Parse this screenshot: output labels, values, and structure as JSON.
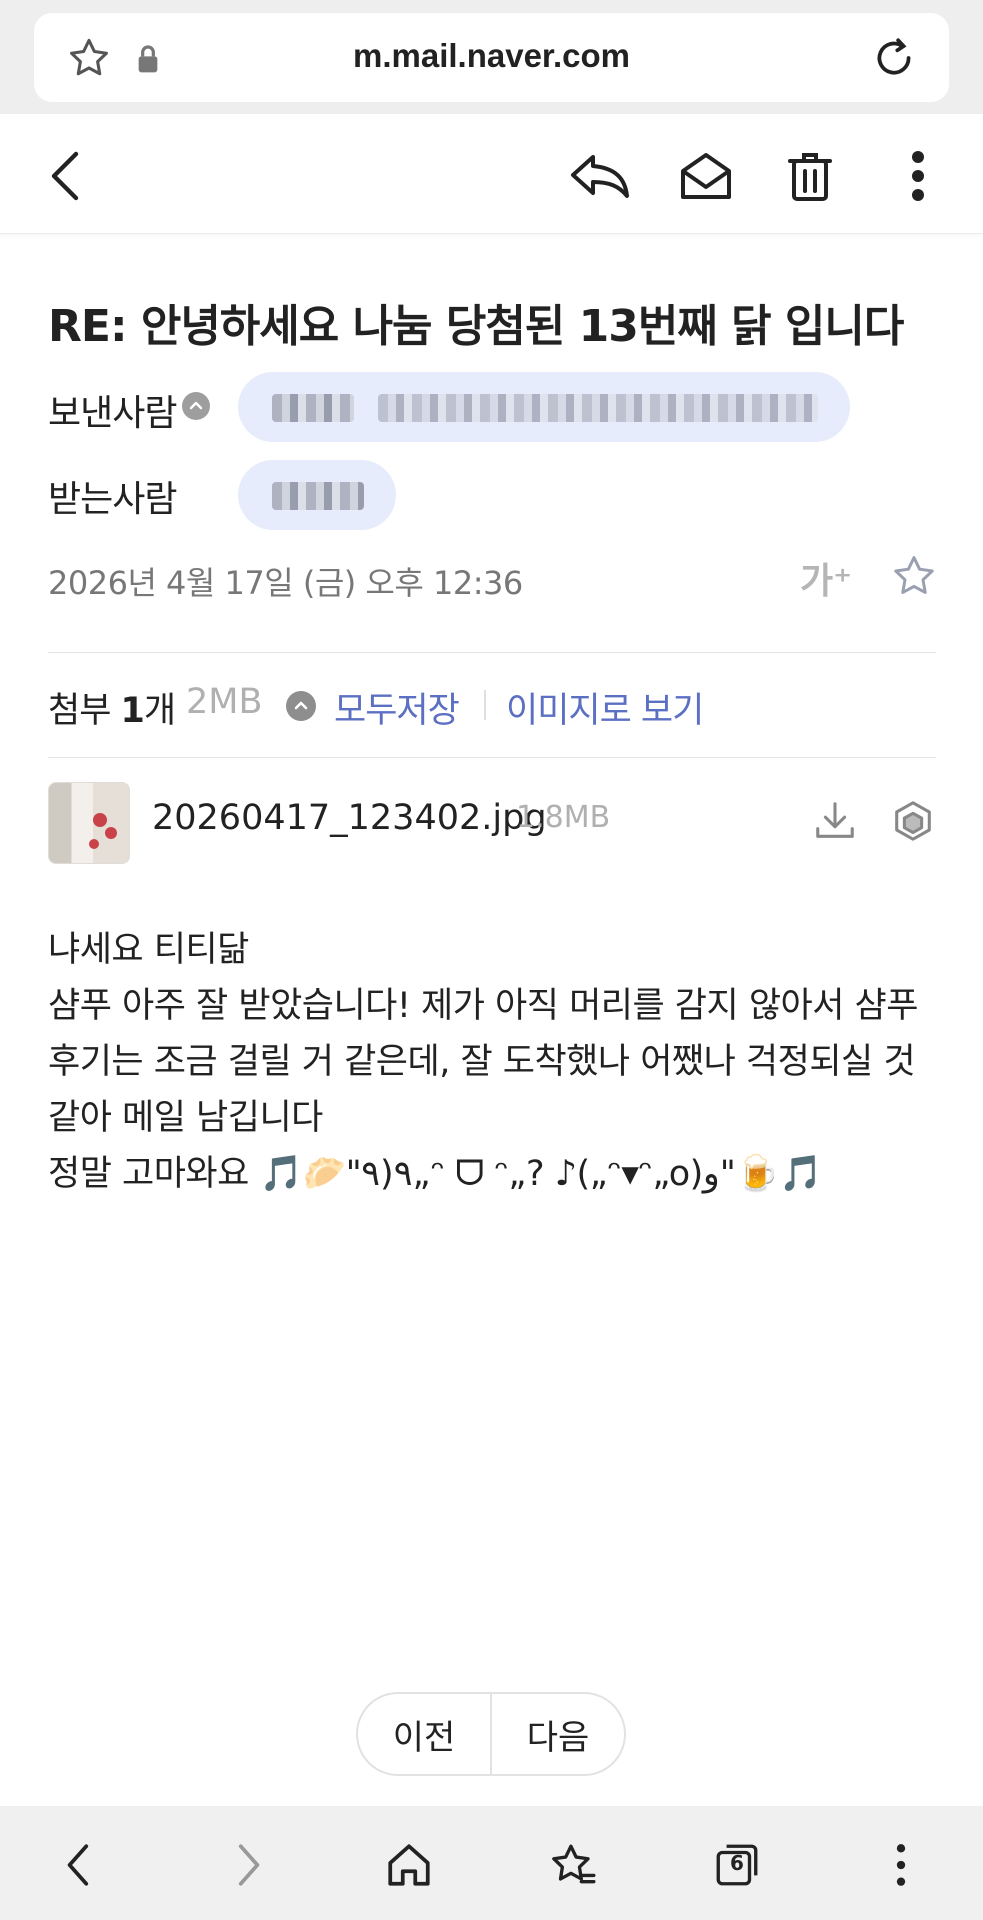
{
  "browser": {
    "url": "m.mail.naver.com"
  },
  "mail": {
    "subject": "RE: 안녕하세요 나눔 당첨된 13번째 닭 입니다",
    "sender_label": "보낸사람",
    "recipient_label": "받는사람",
    "date": "2026년 4월 17일 (금) 오후 12:36",
    "font_size_label": "가⁺",
    "attachments": {
      "label_prefix": "첨부 ",
      "count": "1",
      "label_suffix": "개",
      "total_size": "2MB",
      "save_all": "모두저장",
      "view_as_image": "이미지로 보기",
      "files": [
        {
          "name": "20260417_123402.jpg",
          "size": "1.8MB"
        }
      ]
    },
    "body_lines": [
      "냐세요 티티닮",
      "샴푸 아주 잘 받았습니다! 제가 아직 머리를 감지 않아서 샴푸",
      "후기는 조금 걸릴 거 같은데, 잘 도착했나 어쨌나 걱정되실 것",
      "같아 메일 남깁니다",
      "정말 고마와요 🎵🥟\"٩(٩„ᵔ ᗜ ᵔ„? ♪(„ᵔ▾ᵔ„o)و\"🍺🎵"
    ]
  },
  "pager": {
    "prev": "이전",
    "next": "다음"
  },
  "navbar": {
    "tab_count": "6"
  },
  "colors": {
    "accent": "#5b6fc3",
    "chip": "#e6ecfb",
    "muted": "#777777"
  }
}
